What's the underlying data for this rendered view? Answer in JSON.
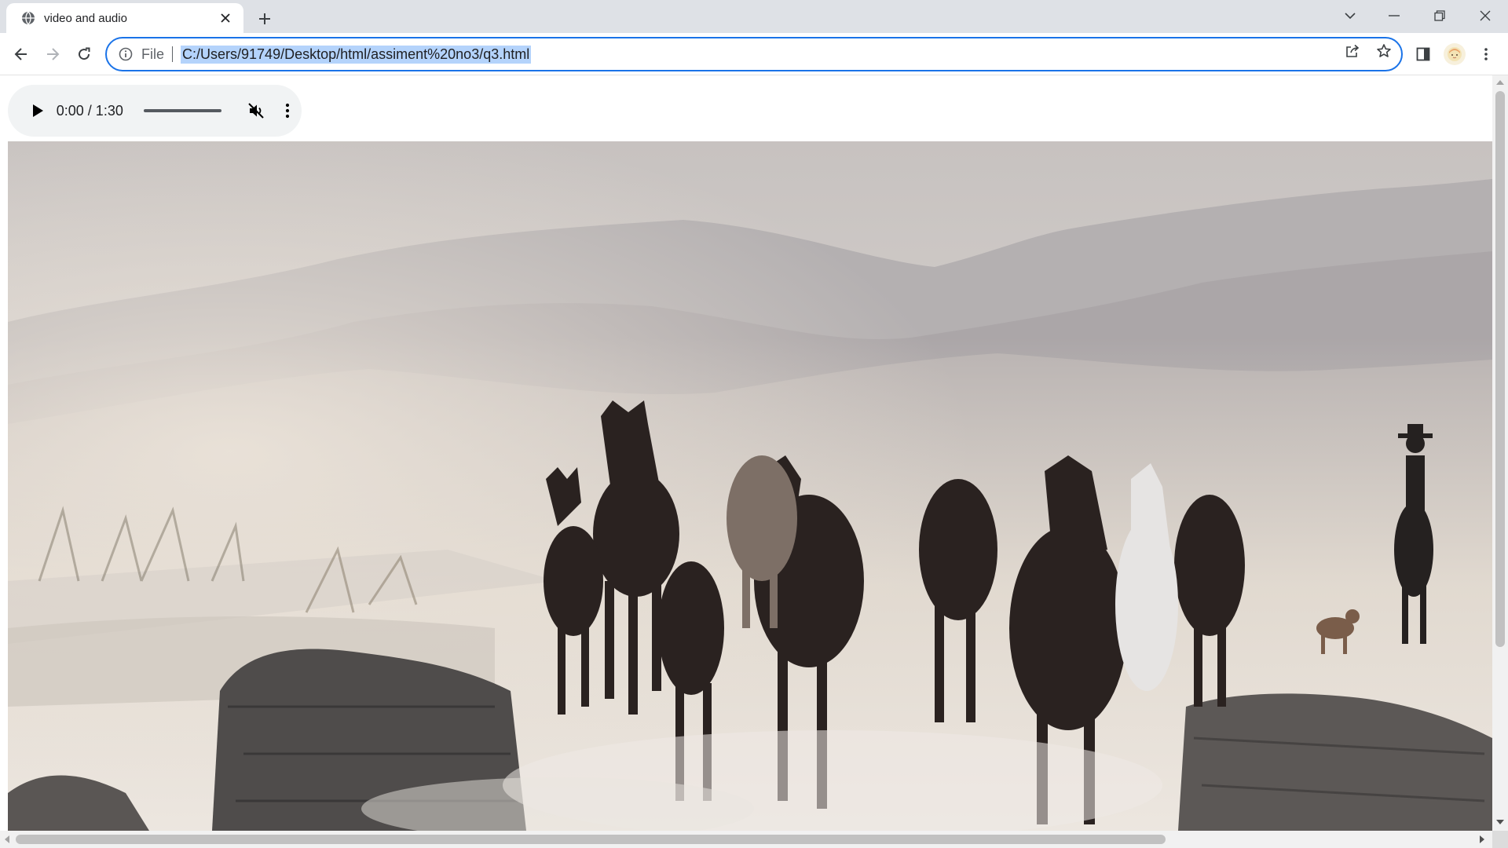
{
  "browser": {
    "tab": {
      "title": "video and audio",
      "favicon": "globe-icon"
    },
    "window_controls": [
      "tab-search-icon",
      "minimize-icon",
      "restore-icon",
      "close-icon"
    ]
  },
  "toolbar": {
    "scheme_label": "File",
    "url": "C:/Users/91749/Desktop/html/assiment%20no3/q3.html",
    "url_selected": true,
    "accent_color": "#1a73e8",
    "selection_color": "#b4d3fb"
  },
  "page": {
    "audio": {
      "time": "0:00 / 1:30",
      "state": "paused",
      "muted": true,
      "progress": 0
    },
    "video": {
      "scene": "herd of horses running through dust with a rider on horseback, mountains in background"
    }
  },
  "scroll": {
    "vertical_thumb_fraction": 0.74,
    "horizontal_thumb_fraction": 0.77
  }
}
